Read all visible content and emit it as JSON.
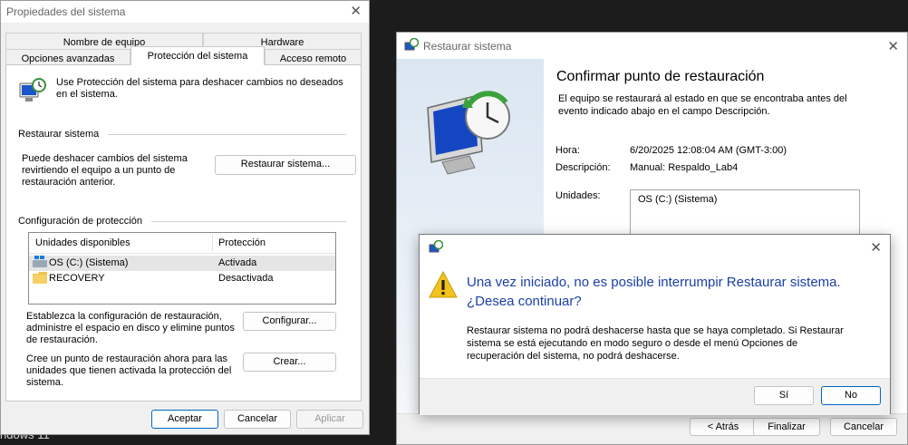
{
  "background": {
    "partial_text": "ndows 11"
  },
  "sysprops": {
    "title": "Propiedades del sistema",
    "tabs_row1": [
      "Nombre de equipo",
      "Hardware"
    ],
    "tabs_row2": [
      "Opciones avanzadas",
      "Protección del sistema",
      "Acceso remoto"
    ],
    "active_tab": "Protección del sistema",
    "intro": [
      "Use Protección del sistema para deshacer cambios no deseados",
      "en el sistema."
    ],
    "restore_group": {
      "label": "Restaurar sistema",
      "desc": [
        "Puede deshacer cambios del sistema",
        "revirtiendo el equipo a un punto de",
        "restauración anterior."
      ],
      "button": "Restaurar sistema..."
    },
    "protection_group": {
      "label": "Configuración de protección",
      "columns": [
        "Unidades disponibles",
        "Protección"
      ],
      "rows": [
        {
          "name": "OS (C:) (Sistema)",
          "status": "Activada",
          "icon": "windows-drive-icon"
        },
        {
          "name": "RECOVERY",
          "status": "Desactivada",
          "icon": "folder-icon"
        }
      ]
    },
    "configure": {
      "desc": [
        "Establezca la configuración de restauración,",
        "administre el espacio en disco y elimine puntos",
        "de restauración."
      ],
      "button": "Configurar..."
    },
    "create": {
      "desc": [
        "Cree un punto de restauración ahora para las",
        "unidades que tienen activada la protección del",
        "sistema."
      ],
      "button": "Crear..."
    },
    "footer": {
      "ok": "Aceptar",
      "cancel": "Cancelar",
      "apply": "Aplicar"
    }
  },
  "restore": {
    "title": "Restaurar sistema",
    "heading": "Confirmar punto de restauración",
    "desc": [
      "El equipo se restaurará al estado en que se encontraba antes del",
      "evento indicado abajo en el campo Descripción."
    ],
    "fields": {
      "hora_label": "Hora:",
      "hora_value": "6/20/2025 12:08:04 AM (GMT-3:00)",
      "desc_label": "Descripción:",
      "desc_value": "Manual: Respaldo_Lab4",
      "units_label": "Unidades:",
      "units_value": "OS (C:) (Sistema)"
    },
    "footer": {
      "back": "< Atrás",
      "finish": "Finalizar",
      "cancel": "Cancelar"
    }
  },
  "dialog": {
    "icon": "warning-icon",
    "question": [
      "Una vez iniciado, no es posible interrumpir Restaurar sistema.",
      "¿Desea continuar?"
    ],
    "body": [
      "Restaurar sistema no podrá deshacerse hasta que se haya completado. Si Restaurar",
      "sistema se está ejecutando en modo seguro o desde el menú Opciones de",
      "recuperación del sistema, no podrá deshacerse."
    ],
    "yes": "Sí",
    "no": "No"
  },
  "colors": {
    "accent": "#0067c0",
    "question_text": "#1a3fa8",
    "sidebar": "#dbe6f1"
  }
}
